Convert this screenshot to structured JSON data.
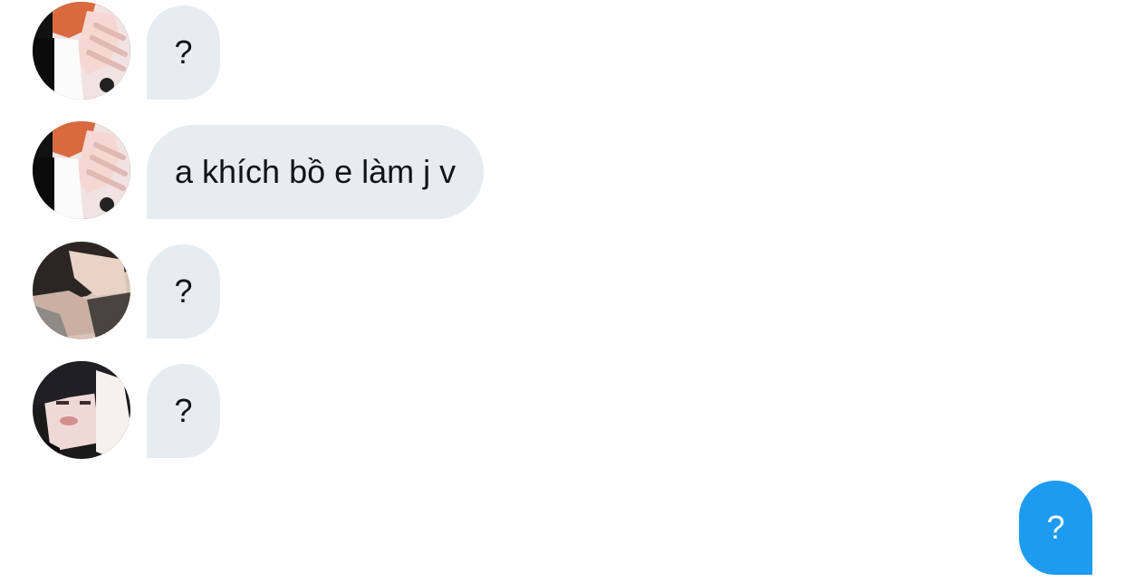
{
  "messages": [
    {
      "author": "received",
      "avatar": "avatar-red-hair-hand",
      "text": "?"
    },
    {
      "author": "received",
      "avatar": "avatar-red-hair-hand",
      "text": "a khích bồ e làm j v"
    },
    {
      "author": "received",
      "avatar": "avatar-dark-hair-hand",
      "text": "?"
    },
    {
      "author": "received",
      "avatar": "avatar-dark-hair-hood",
      "text": "?"
    },
    {
      "author": "sent",
      "text": "?"
    }
  ],
  "colors": {
    "received_bubble": "#e7ecf0",
    "sent_bubble": "#1d9bf0",
    "text_dark": "#0f1419",
    "text_light": "#ffffff"
  }
}
